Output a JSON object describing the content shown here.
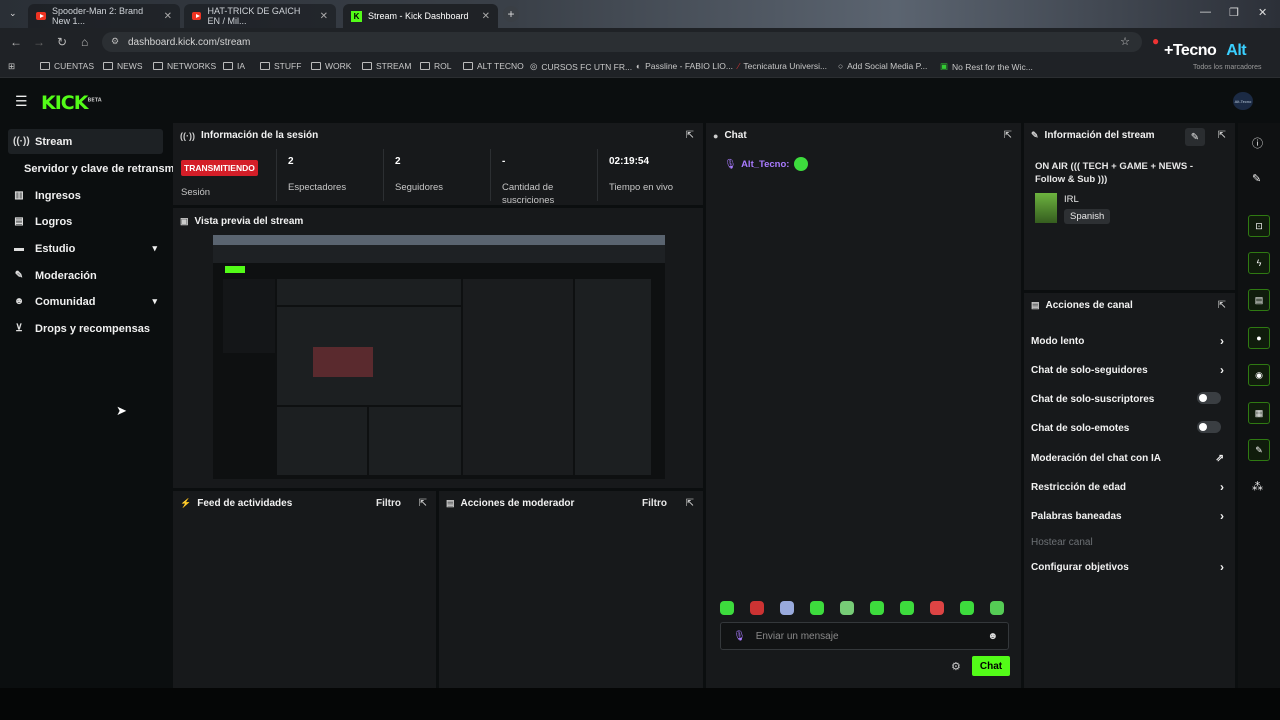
{
  "browser": {
    "tabs": [
      {
        "title": "Spooder-Man 2: Brand New 1...",
        "kind": "youtube",
        "active": false
      },
      {
        "title": "HAT-TRICK DE GAICH EN / Mil...",
        "kind": "youtube",
        "active": false
      },
      {
        "title": "Stream - Kick Dashboard",
        "kind": "kick",
        "active": true
      }
    ],
    "url": "dashboard.kick.com/stream",
    "bookmarks": [
      "CUENTAS",
      "NEWS",
      "NETWORKS",
      "IA",
      "STUFF",
      "WORK",
      "STREAM",
      "ROL",
      "ALT TECNO",
      "CURSOS FC UTN FR...",
      "Passline - FABIO LIO...",
      "Tecnicatura Universi...",
      "Add Social Media P...",
      "No Rest for the Wic...",
      "Todos los marcadores"
    ],
    "overlay_logo": {
      "left": "+Tecno",
      "right": "Alt"
    }
  },
  "app": {
    "logo": "KICK",
    "beta": "BETA",
    "avatar_label": "Alt-Tecno"
  },
  "sidebar": {
    "items": [
      {
        "label": "Stream",
        "icon": "broadcast-icon",
        "selected": true
      },
      {
        "label": "Servidor y clave de retransm",
        "icon": "",
        "selected": false
      },
      {
        "label": "Ingresos",
        "icon": "chart-icon",
        "selected": false
      },
      {
        "label": "Logros",
        "icon": "trophy-icon",
        "selected": false
      },
      {
        "label": "Estudio",
        "icon": "studio-icon",
        "selected": false,
        "expand": true
      },
      {
        "label": "Moderación",
        "icon": "wrench-icon",
        "selected": false
      },
      {
        "label": "Comunidad",
        "icon": "people-icon",
        "selected": false,
        "expand": true
      },
      {
        "label": "Drops y recompensas",
        "icon": "drops-icon",
        "selected": false
      }
    ]
  },
  "session": {
    "title": "Información de la sesión",
    "status": "TRANSMITIENDO",
    "status_label": "Sesión",
    "stats": [
      {
        "value": "2",
        "label": "Espectadores"
      },
      {
        "value": "2",
        "label": "Seguidores"
      },
      {
        "value": "-",
        "label": "Cantidad de suscriciones"
      },
      {
        "value": "02:19:54",
        "label": "Tiempo en vivo"
      }
    ]
  },
  "preview": {
    "title": "Vista previa del stream"
  },
  "feed": {
    "title": "Feed de actividades",
    "filter": "Filtro"
  },
  "modactions": {
    "title": "Acciones de moderador",
    "filter": "Filtro"
  },
  "chat": {
    "title": "Chat",
    "messages": [
      {
        "user": "Alt_Tecno:",
        "emote": true
      }
    ],
    "emote_count": 10,
    "placeholder": "Enviar un mensaje",
    "send": "Chat"
  },
  "stream_info": {
    "title": "Información del stream",
    "stream_title": "ON AIR ((( TECH + GAME + NEWS - Follow & Sub )))",
    "category": "IRL",
    "language": "Spanish"
  },
  "channel_actions": {
    "title": "Acciones de canal",
    "items": [
      {
        "label": "Modo lento",
        "control": "arrow"
      },
      {
        "label": "Chat de solo-seguidores",
        "control": "arrow"
      },
      {
        "label": "Chat de solo-suscriptores",
        "control": "toggle",
        "on": false
      },
      {
        "label": "Chat de solo-emotes",
        "control": "toggle",
        "on": false
      },
      {
        "label": "Moderación del chat con IA",
        "control": "external"
      },
      {
        "label": "Restricción de edad",
        "control": "arrow"
      },
      {
        "label": "Palabras baneadas",
        "control": "arrow"
      },
      {
        "label": "Hostear canal",
        "control": "disabled"
      },
      {
        "label": "Configurar objetivos",
        "control": "arrow"
      }
    ]
  }
}
